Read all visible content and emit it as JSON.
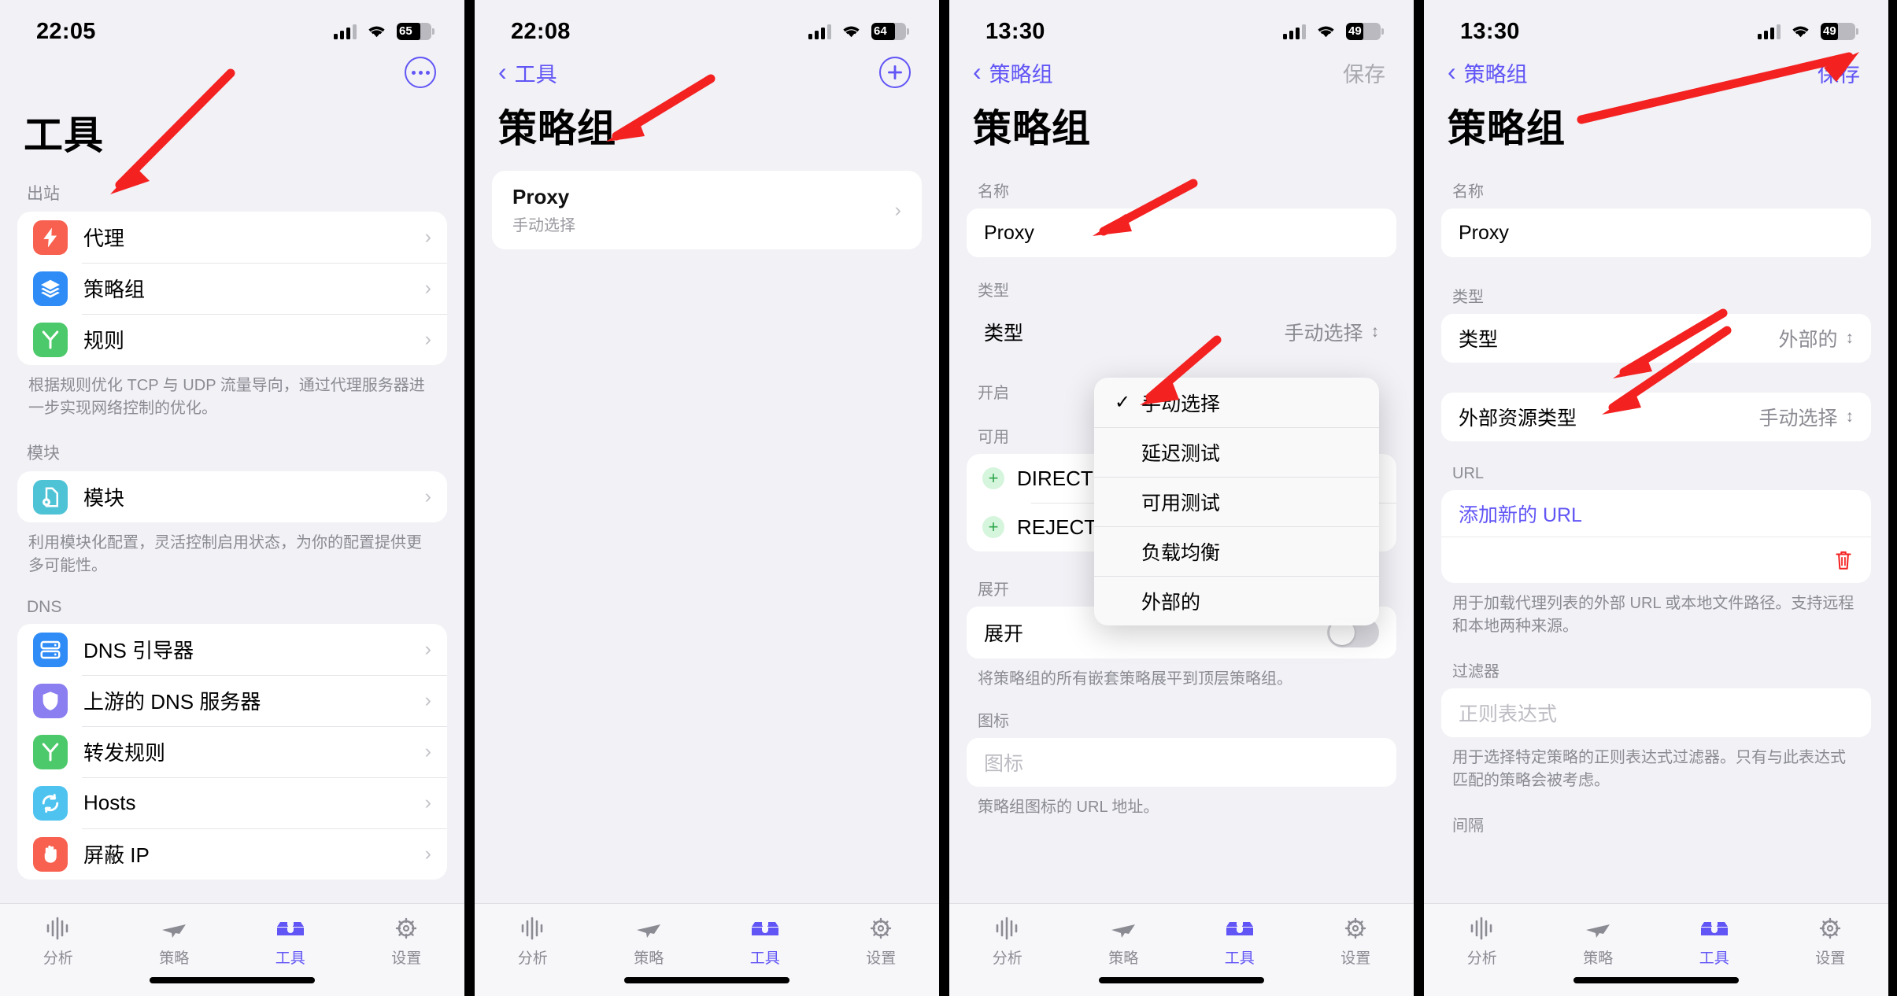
{
  "panels": [
    {
      "status": {
        "time": "22:05",
        "battery": "65"
      },
      "title": "工具",
      "sections": [
        {
          "header": "出站",
          "items": [
            {
              "label": "代理",
              "icon": "bolt-icon",
              "color": "#f8604f"
            },
            {
              "label": "策略组",
              "icon": "layers-icon",
              "color": "#2f8cf6"
            },
            {
              "label": "规则",
              "icon": "branch-icon",
              "color": "#4cc96a"
            }
          ],
          "note": "根据规则优化 TCP 与 UDP 流量导向，通过代理服务器进一步实现网络控制的优化。"
        },
        {
          "header": "模块",
          "items": [
            {
              "label": "模块",
              "icon": "module-file-icon",
              "color": "#4fc3d6"
            }
          ],
          "note": "利用模块化配置，灵活控制启用状态，为你的配置提供更多可能性。"
        },
        {
          "header": "DNS",
          "items": [
            {
              "label": "DNS 引导器",
              "icon": "server-icon",
              "color": "#2f8cf6"
            },
            {
              "label": "上游的 DNS 服务器",
              "icon": "shield-icon",
              "color": "#8a7ef0"
            },
            {
              "label": "转发规则",
              "icon": "branch-icon",
              "color": "#4cc96a"
            },
            {
              "label": "Hosts",
              "icon": "sync-icon",
              "color": "#4fc3ef"
            },
            {
              "label": "屏蔽 IP",
              "icon": "hand-icon",
              "color": "#f8604f"
            }
          ],
          "note": ""
        }
      ]
    },
    {
      "status": {
        "time": "22:08",
        "battery": "64"
      },
      "nav": {
        "back": "工具",
        "add": "+"
      },
      "title": "策略组",
      "list": [
        {
          "name": "Proxy",
          "subtitle": "手动选择"
        }
      ]
    },
    {
      "status": {
        "time": "13:30",
        "battery": "49"
      },
      "nav": {
        "back": "策略组",
        "action": "保存",
        "action_disabled": true
      },
      "title": "策略组",
      "fields": {
        "name_label": "名称",
        "name_value": "Proxy",
        "type_label": "类型",
        "type_row_label": "类型",
        "type_value": "手动选择",
        "enabled_label": "开启",
        "available_label": "可用",
        "available_items": [
          "DIRECT",
          "REJECT"
        ],
        "expand_label": "展开",
        "expand_row_label": "展开",
        "expand_note": "将策略组的所有嵌套策略展平到顶层策略组。",
        "icon_label": "图标",
        "icon_placeholder": "图标",
        "icon_note": "策略组图标的 URL 地址。"
      },
      "menu": {
        "options": [
          {
            "label": "手动选择",
            "checked": true
          },
          {
            "label": "延迟测试",
            "checked": false
          },
          {
            "label": "可用测试",
            "checked": false
          },
          {
            "label": "负载均衡",
            "checked": false
          },
          {
            "label": "外部的",
            "checked": false
          }
        ]
      }
    },
    {
      "status": {
        "time": "13:30",
        "battery": "49"
      },
      "nav": {
        "back": "策略组",
        "action": "保存",
        "action_disabled": false
      },
      "title": "策略组",
      "fields": {
        "name_label": "名称",
        "name_value": "Proxy",
        "type_label": "类型",
        "type_row_label": "类型",
        "type_value": "外部的",
        "ext_res_label": "外部资源类型",
        "ext_res_value": "手动选择",
        "url_label": "URL",
        "url_add": "添加新的 URL",
        "url_note": "用于加载代理列表的外部 URL 或本地文件路径。支持远程和本地两种来源。",
        "filter_label": "过滤器",
        "filter_placeholder": "正则表达式",
        "filter_note": "用于选择特定策略的正则表达式过滤器。只有与此表达式匹配的策略会被考虑。",
        "interval_label": "间隔"
      }
    }
  ],
  "tabbar": {
    "items": [
      {
        "label": "分析",
        "icon": "waveform-icon",
        "active": false
      },
      {
        "label": "策略",
        "icon": "airplane-icon",
        "active": false
      },
      {
        "label": "工具",
        "icon": "toolbox-icon",
        "active": true
      },
      {
        "label": "设置",
        "icon": "gear-icon",
        "active": false
      }
    ]
  },
  "colors": {
    "accent": "#6155f5",
    "bg": "#f1f1f6",
    "card": "#ffffff",
    "annotation": "#f42121"
  }
}
